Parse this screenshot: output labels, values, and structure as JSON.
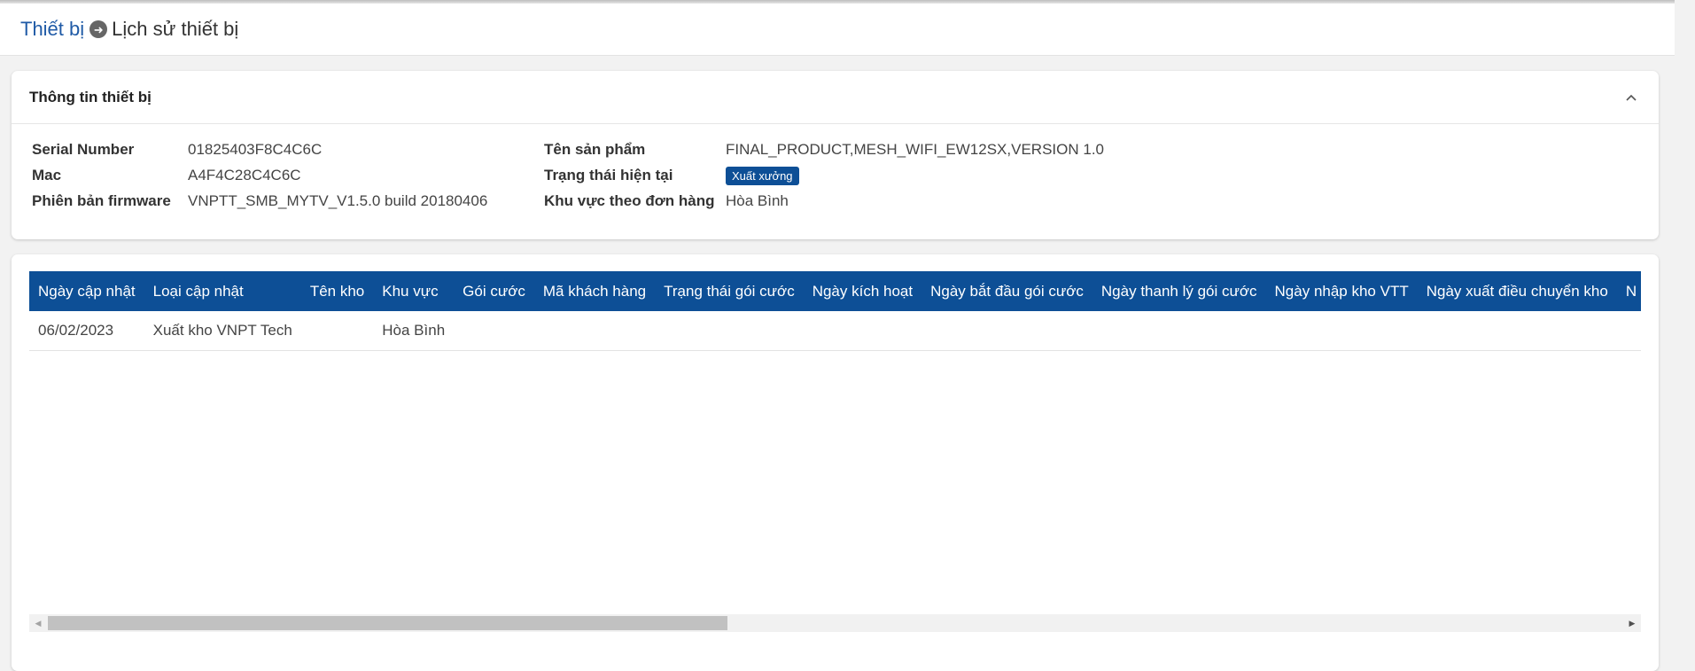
{
  "breadcrumb": {
    "parent": "Thiết bị",
    "separator_icon": "arrow-circle-right-icon",
    "current": "Lịch sử thiết bị"
  },
  "device_info": {
    "title": "Thông tin thiết bị",
    "serial_label": "Serial Number",
    "serial_value": "01825403F8C4C6C",
    "mac_label": "Mac",
    "mac_value": "A4F4C28C4C6C",
    "firmware_label": "Phiên bản firmware",
    "firmware_value": "VNPTT_SMB_MYTV_V1.5.0 build 20180406",
    "product_label": "Tên sản phẩm",
    "product_value": "FINAL_PRODUCT,MESH_WIFI_EW12SX,VERSION 1.0",
    "status_label": "Trạng thái hiện tại",
    "status_value": "Xuất xưởng",
    "region_label": "Khu vực theo đơn hàng",
    "region_value": "Hòa Bình"
  },
  "history_table": {
    "columns": [
      "Ngày cập nhật",
      "Loại cập nhật",
      "Tên kho",
      "Khu vực",
      "Gói cước",
      "Mã khách hàng",
      "Trạng thái gói cước",
      "Ngày kích hoạt",
      "Ngày bắt đầu gói cước",
      "Ngày thanh lý gói cước",
      "Ngày nhập kho VTT",
      "Ngày xuất điều chuyển kho",
      "N"
    ],
    "rows": [
      [
        "06/02/2023",
        "Xuất kho VNPT Tech",
        "",
        "Hòa Bình",
        "",
        "",
        "",
        "",
        "",
        "",
        "",
        "",
        ""
      ]
    ]
  },
  "colors": {
    "primary": "#0d4f96",
    "link": "#1f5aa6"
  }
}
